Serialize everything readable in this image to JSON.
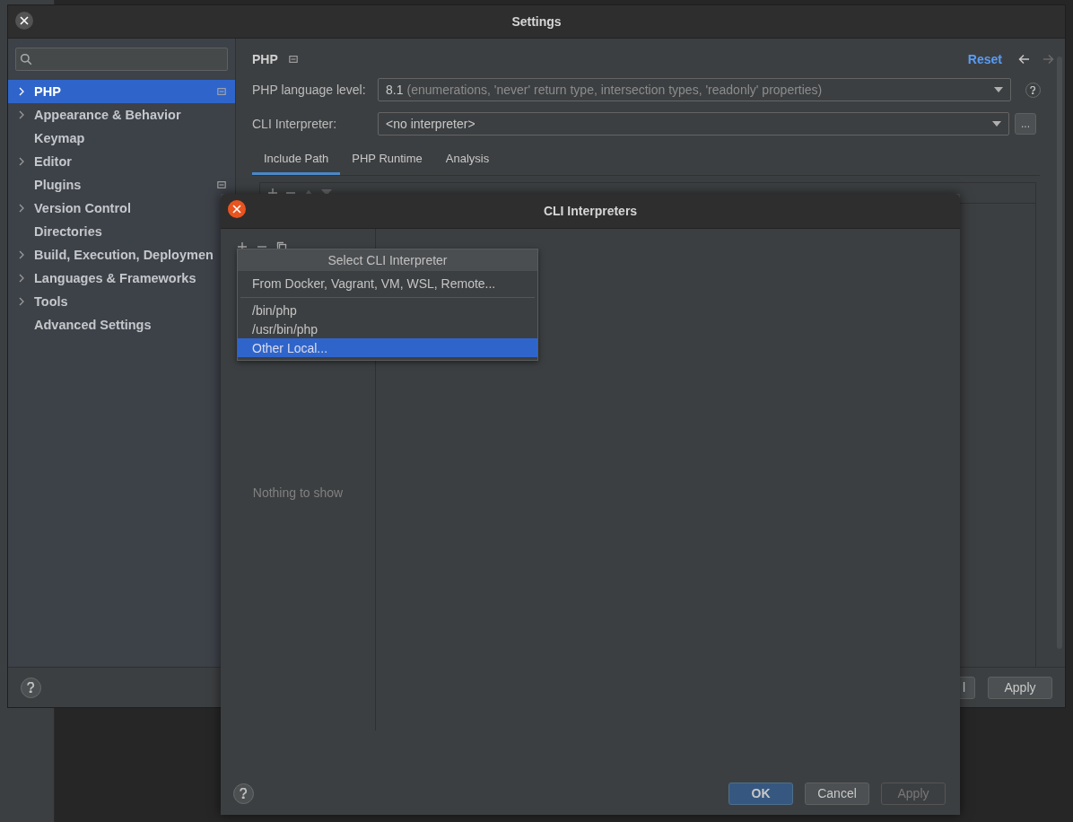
{
  "settings": {
    "title": "Settings",
    "sidebar": [
      {
        "label": "PHP",
        "expandable": true,
        "selected": true,
        "badge": true
      },
      {
        "label": "Appearance & Behavior",
        "expandable": true,
        "selected": false,
        "badge": false
      },
      {
        "label": "Keymap",
        "expandable": false,
        "selected": false,
        "badge": false
      },
      {
        "label": "Editor",
        "expandable": true,
        "selected": false,
        "badge": false
      },
      {
        "label": "Plugins",
        "expandable": false,
        "selected": false,
        "badge": true
      },
      {
        "label": "Version Control",
        "expandable": true,
        "selected": false,
        "badge": false
      },
      {
        "label": "Directories",
        "expandable": false,
        "selected": false,
        "badge": false
      },
      {
        "label": "Build, Execution, Deploymen",
        "expandable": true,
        "selected": false,
        "badge": false
      },
      {
        "label": "Languages & Frameworks",
        "expandable": true,
        "selected": false,
        "badge": false
      },
      {
        "label": "Tools",
        "expandable": true,
        "selected": false,
        "badge": false
      },
      {
        "label": "Advanced Settings",
        "expandable": false,
        "selected": false,
        "badge": false
      }
    ],
    "page": {
      "title": "PHP",
      "reset": "Reset",
      "fields": [
        {
          "label": "PHP language level:",
          "value": "8.1",
          "hint": "(enumerations, 'never' return type, intersection types, 'readonly' properties)",
          "kind": "help"
        },
        {
          "label": "CLI Interpreter:",
          "value": "<no interpreter>",
          "kind": "more",
          "more": "..."
        }
      ],
      "tabs": [
        {
          "label": "Include Path",
          "selected": true
        },
        {
          "label": "PHP Runtime",
          "selected": false
        },
        {
          "label": "Analysis",
          "selected": false
        }
      ]
    },
    "footer": {
      "buttons": [
        {
          "label": "l"
        },
        {
          "label": "Apply"
        }
      ]
    }
  },
  "dialog": {
    "title": "CLI Interpreters",
    "empty_text": "Nothing to show",
    "buttons": [
      {
        "label": "OK",
        "kind": "default",
        "disabled": false
      },
      {
        "label": "Cancel",
        "kind": "normal",
        "disabled": false
      },
      {
        "label": "Apply",
        "kind": "normal",
        "disabled": true
      }
    ]
  },
  "popup": {
    "title": "Select CLI Interpreter",
    "groups": [
      [
        {
          "label": "From Docker, Vagrant, VM, WSL, Remote...",
          "selected": false
        }
      ],
      [
        {
          "label": "/bin/php",
          "selected": false
        },
        {
          "label": "/usr/bin/php",
          "selected": false
        },
        {
          "label": "Other Local...",
          "selected": true
        }
      ]
    ]
  }
}
